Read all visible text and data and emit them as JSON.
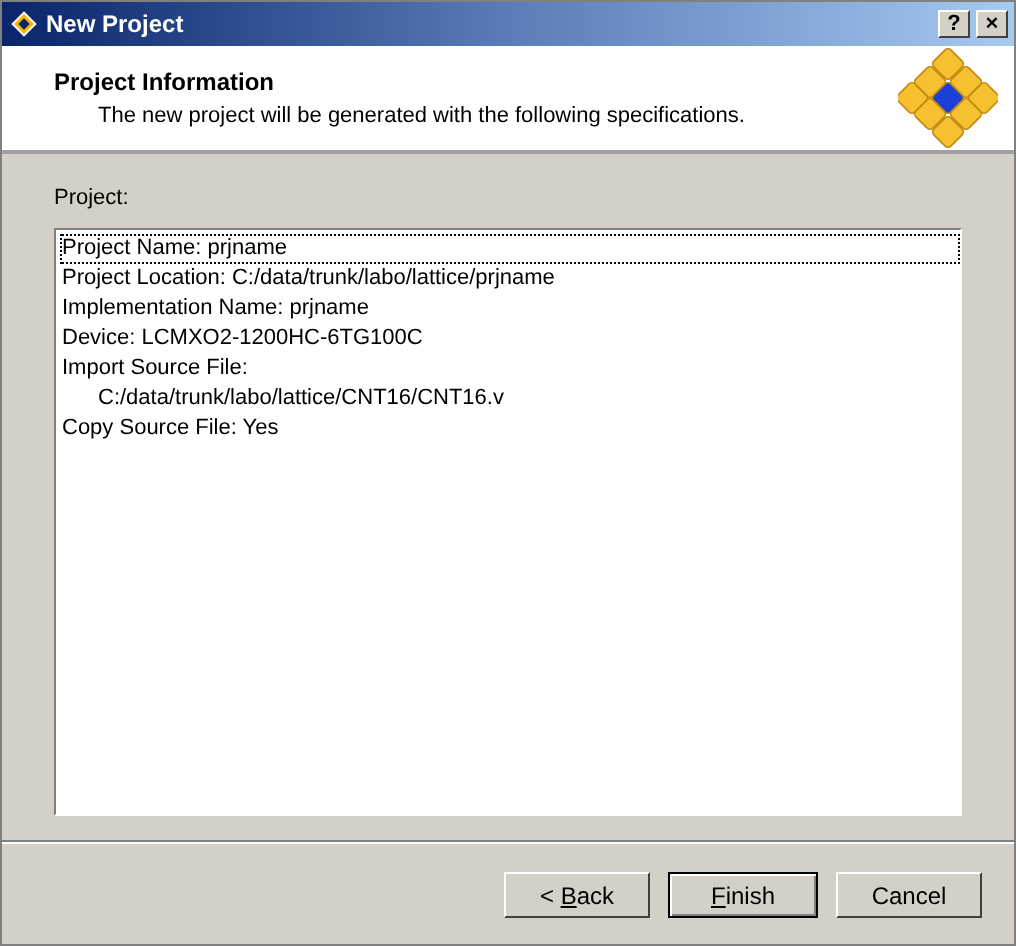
{
  "window": {
    "title": "New Project",
    "title_buttons": [
      "?",
      "×"
    ]
  },
  "header": {
    "title": "Project Information",
    "subtitle": "The new project will be generated with the following specifications."
  },
  "project": {
    "label": "Project:",
    "lines": [
      {
        "text": "Project Name: prjname",
        "kind": "line",
        "focused": true
      },
      {
        "text": "Project Location: C:/data/trunk/labo/lattice/prjname",
        "kind": "line",
        "focused": false
      },
      {
        "text": "Implementation Name: prjname",
        "kind": "line",
        "focused": false
      },
      {
        "text": "Device: LCMXO2-1200HC-6TG100C",
        "kind": "line",
        "focused": false
      },
      {
        "text": "Import Source File:",
        "kind": "line",
        "focused": false
      },
      {
        "text": "C:/data/trunk/labo/lattice/CNT16/CNT16.v",
        "kind": "indented",
        "focused": false
      },
      {
        "text": "Copy Source File: Yes",
        "kind": "line",
        "focused": false
      }
    ]
  },
  "buttons": [
    {
      "prefix": "< ",
      "key": "B",
      "rest": "ack",
      "default": false
    },
    {
      "key": "F",
      "rest": "inish",
      "default": true
    },
    {
      "rest": "Cancel",
      "default": false
    }
  ]
}
